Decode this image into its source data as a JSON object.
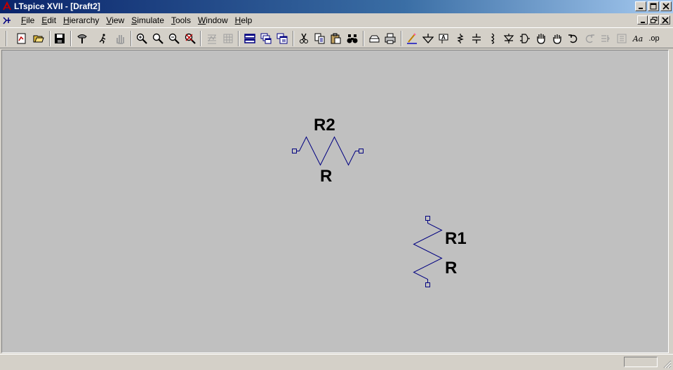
{
  "window": {
    "title": "LTspice XVII - [Draft2]"
  },
  "menu": {
    "items": [
      {
        "key": "F",
        "rest": "ile"
      },
      {
        "key": "E",
        "rest": "dit"
      },
      {
        "key": "H",
        "rest": "ierarchy"
      },
      {
        "key": "V",
        "rest": "iew"
      },
      {
        "key": "S",
        "rest": "imulate"
      },
      {
        "key": "T",
        "rest": "ools"
      },
      {
        "key": "W",
        "rest": "indow"
      },
      {
        "key": "H",
        "rest": "elp"
      }
    ]
  },
  "toolbar": {
    "text_button": "Aa",
    "spice_directive": ".op",
    "icons": [
      "new-schematic-icon",
      "open-icon",
      "save-icon",
      "control-panel-icon",
      "run-icon",
      "halt-icon",
      "zoom-in-icon",
      "pan-icon",
      "zoom-out-icon",
      "zoom-fit-icon",
      "autorange-icon",
      "unzoom-icon",
      "tile-horizontal-icon",
      "cascade-icon",
      "tile-vertical-icon",
      "cut-icon",
      "copy-icon",
      "paste-icon",
      "find-icon",
      "print-setup-icon",
      "print-icon",
      "wire-icon",
      "ground-icon",
      "label-net-icon",
      "resistor-icon",
      "capacitor-icon",
      "inductor-icon",
      "diode-icon",
      "component-icon",
      "move-icon",
      "drag-icon",
      "undo-icon",
      "redo-icon",
      "rotate-icon",
      "mirror-icon"
    ]
  },
  "schematic": {
    "components": [
      {
        "ref": "R2",
        "value": "R",
        "orientation": "horizontal"
      },
      {
        "ref": "R1",
        "value": "R",
        "orientation": "vertical"
      }
    ],
    "wire_color": "#000080"
  }
}
